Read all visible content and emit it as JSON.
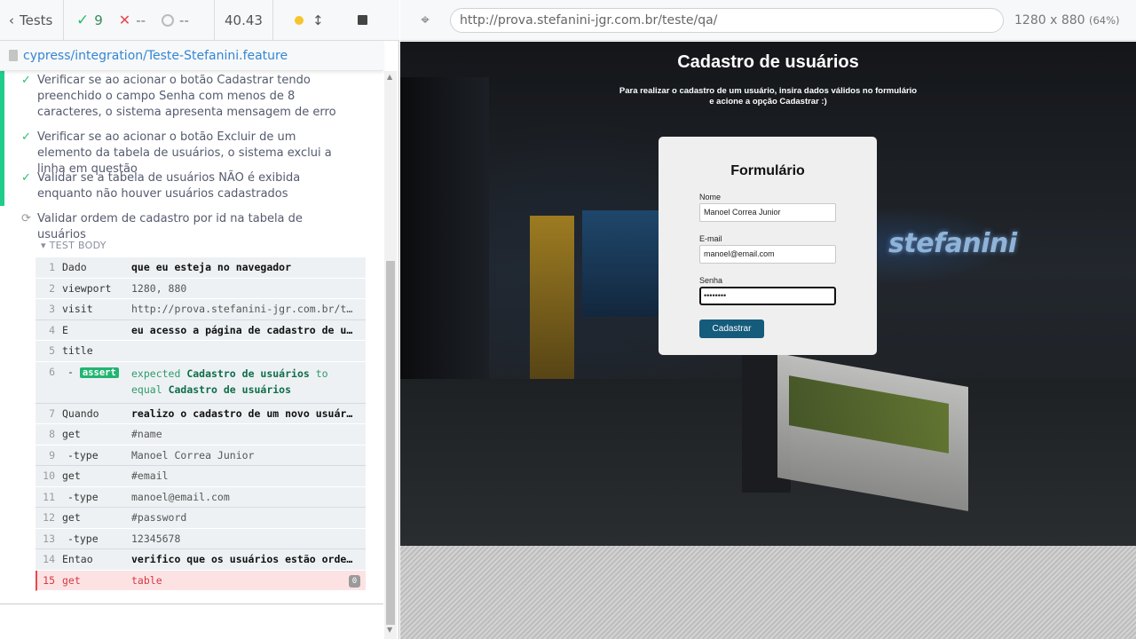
{
  "reporter": {
    "tests_label": "Tests",
    "passed": "9",
    "failed": "--",
    "pending": "--",
    "duration": "40.43",
    "spec_file": "cypress/integration/Teste-Stefanini.feature",
    "tests": [
      {
        "title": "Verificar se ao acionar o botão Cadastrar tendo preenchido o campo Senha com menos de 8 caracteres, o sistema apresenta mensagem de erro",
        "state": "passed"
      },
      {
        "title": "Verificar se ao acionar o botão Excluir de um elemento da tabela de usuários, o sistema exclui a linha em questão",
        "state": "passed"
      },
      {
        "title": "Validar se a tabela de usuários NÃO é exibida enquanto não houver usuários cadastrados",
        "state": "passed"
      },
      {
        "title": "Validar ordem de cadastro por id na tabela de usuários",
        "state": "running"
      }
    ],
    "test_body_label": "TEST BODY",
    "commands": [
      {
        "n": "1",
        "name": "Dado",
        "msg": "que eu esteja no navegador"
      },
      {
        "n": "2",
        "name": "viewport",
        "msg": "1280, 880"
      },
      {
        "n": "3",
        "name": "visit",
        "msg": "http://prova.stefanini-jgr.com.br/teste/qa/"
      },
      {
        "n": "4",
        "name": "E",
        "msg": "eu acesso a página de cadastro de usuários"
      },
      {
        "n": "5",
        "name": "title",
        "msg": ""
      },
      {
        "n": "6",
        "name": "-",
        "badge": "assert",
        "assert": {
          "expected": "expected",
          "value1": "Cadastro de usuários",
          "to": "to",
          "equal": "equal",
          "value2": "Cadastro de usuários"
        }
      },
      {
        "n": "7",
        "name": "Quando",
        "msg": "realizo o cadastro de um novo usuário"
      },
      {
        "n": "8",
        "name": "get",
        "msg": "#name"
      },
      {
        "n": "9",
        "name": "-type",
        "msg": "Manoel Correa Junior"
      },
      {
        "n": "10",
        "name": "get",
        "msg": "#email"
      },
      {
        "n": "11",
        "name": "-type",
        "msg": "manoel@email.com"
      },
      {
        "n": "12",
        "name": "get",
        "msg": "#password"
      },
      {
        "n": "13",
        "name": "-type",
        "msg": "12345678"
      },
      {
        "n": "14",
        "name": "Entao",
        "msg": "verifico que os usuários estão ordenados"
      },
      {
        "n": "15",
        "name": "get",
        "msg": "table",
        "badge": "0"
      }
    ]
  },
  "aut": {
    "url": "http://prova.stefanini-jgr.com.br/teste/qa/",
    "viewport": "1280 x 880",
    "zoom": "(64%)",
    "page_title": "Cadastro de usuários",
    "page_subtitle_1": "Para realizar o cadastro de um usuário, insira dados válidos no formulário",
    "page_subtitle_2": "e acione a opção Cadastrar :)",
    "logo_text": "stefanini",
    "form": {
      "title": "Formulário",
      "name_label": "Nome",
      "name_value": "Manoel Correa Junior",
      "email_label": "E-mail",
      "email_value": "manoel@email.com",
      "password_label": "Senha",
      "password_value": "••••••••",
      "submit_label": "Cadastrar"
    }
  },
  "colors": {
    "pass": "#2cbf6b",
    "fail": "#e8474d",
    "link": "#3386d4",
    "submit": "#155b7b"
  }
}
